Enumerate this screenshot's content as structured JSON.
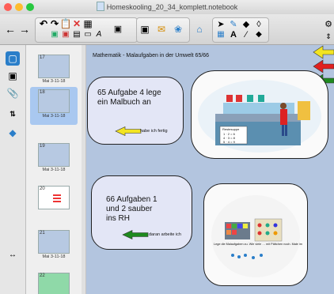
{
  "window": {
    "title": "Homeskooling_20_34_komplett.notebook"
  },
  "toolbar": {
    "icons": [
      "back-icon",
      "forward-icon",
      "undo-icon",
      "redo-icon",
      "paste-icon",
      "delete-icon",
      "table-icon",
      "screen-icon",
      "capture-icon",
      "gallery-icon",
      "addon-icon",
      "home-icon",
      "select-icon",
      "pen-icon",
      "eraser-icon",
      "shape-icon",
      "text-icon",
      "line-icon",
      "fill-icon",
      "settings-icon"
    ]
  },
  "thumbnails": [
    {
      "num": "17",
      "label": "Mai 3-11-18"
    },
    {
      "num": "18",
      "label": "Mai 3-11-18",
      "selected": true
    },
    {
      "num": "19",
      "label": "Mai 3-11-18"
    },
    {
      "num": "20",
      "label": ""
    },
    {
      "num": "21",
      "label": "Mai 3-11-18"
    },
    {
      "num": "22",
      "label": ""
    }
  ],
  "page": {
    "heading": "Mathematik - Malaufgaben in der Umwelt 65/66",
    "task1": {
      "line1": "65 Aufgabe 4 lege",
      "line2": "ein Malbuch an",
      "status": "habe ich fertig"
    },
    "task2": {
      "line1": "66 Aufgaben 1",
      "line2": "und 2 sauber",
      "line3": "ins RH",
      "status": "daran arbeite ich"
    },
    "kitchen_note": "Restesuppe",
    "board_lines": [
      "1 · 2 = 6",
      "4 · 3 = 8",
      "5 · 4 = 9"
    ],
    "caption": "Lege die Malaufgaben zu. Wie viele … mit Pättchen noch. Male im"
  },
  "colors": {
    "yellow": "#f2e422",
    "red": "#e02020",
    "green": "#1e8a1e",
    "canvas": "#b3c5df"
  }
}
